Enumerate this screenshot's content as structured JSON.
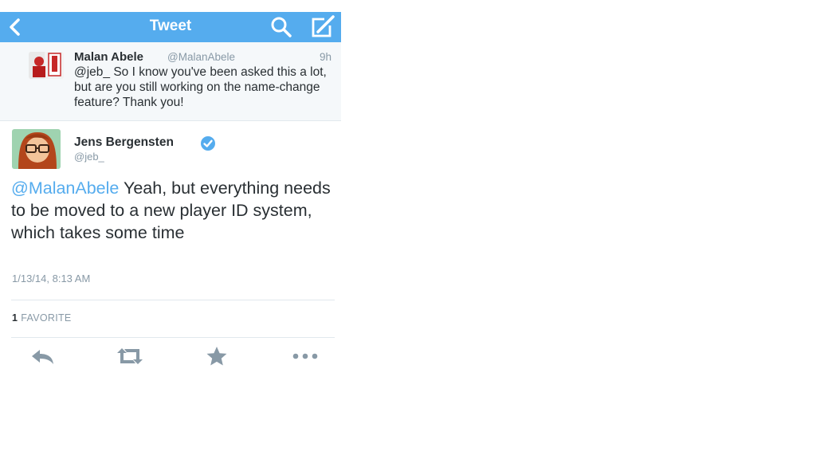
{
  "navbar": {
    "title": "Tweet"
  },
  "reply_context": {
    "name": "Malan Abele",
    "handle": "@MalanAbele",
    "time": "9h",
    "text": "@jeb_ So I know you've been asked this a lot, but are you still working on the name-change feature? Thank you!"
  },
  "tweet": {
    "name": "Jens Bergensten",
    "handle": "@jeb_",
    "mention": "@MalanAbele",
    "text": " Yeah, but everything needs to be moved to a new player ID system, which takes some time",
    "date": "1/13/14, 8:13 AM",
    "favorite_count": "1",
    "favorite_label": "FAVORITE"
  },
  "colors": {
    "accent": "#55acee",
    "verified": "#55acee",
    "muted": "#8899a6"
  },
  "icons": [
    "back-icon",
    "search-icon",
    "compose-icon",
    "verified-icon",
    "reply-icon",
    "retweet-icon",
    "favorite-icon",
    "more-icon"
  ]
}
